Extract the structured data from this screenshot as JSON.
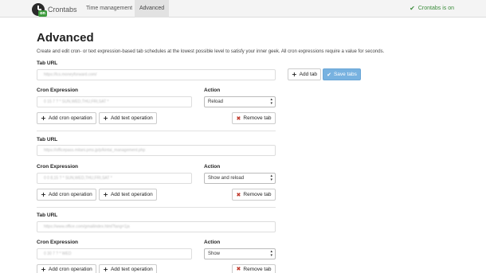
{
  "nav": {
    "brand": "Crontabs",
    "logo_badge": "on",
    "tabs": [
      {
        "label": "Time management",
        "active": false
      },
      {
        "label": "Advanced",
        "active": true
      }
    ],
    "status": "Crontabs is on",
    "status_color": "#3c8d3c"
  },
  "page": {
    "title": "Advanced",
    "description": "Create and edit cron- or text expression-based tab schedules at the lowest possible level to satisfy your inner geek. All cron expressions require a value for seconds."
  },
  "labels": {
    "tab_url": "Tab URL",
    "cron_expression": "Cron Expression",
    "action": "Action"
  },
  "buttons": {
    "add_tab": "Add tab",
    "save_tabs": "Save tabs",
    "add_cron": "Add cron operation",
    "add_text": "Add text operation",
    "remove_tab": "Remove tab"
  },
  "colors": {
    "primary": "#78b2e0",
    "remove_icon": "#c0392b"
  },
  "tabs": [
    {
      "url": "https://lcs.moneyforward.com/",
      "cron": "0 15 7 ? * SUN,WED,THU,FRI,SAT *",
      "action": "Reload"
    },
    {
      "url": "https://officepass.mitani.pms.jp/p/kintai_management.php",
      "cron": "0 0 8,15 ? * SUN,WED,THU,FRI,SAT *",
      "action": "Show and reload"
    },
    {
      "url": "https://www.office.com/gmailindex.html?lang=1ja",
      "cron": "0 30 7 ? * WED",
      "action": "Show"
    }
  ]
}
